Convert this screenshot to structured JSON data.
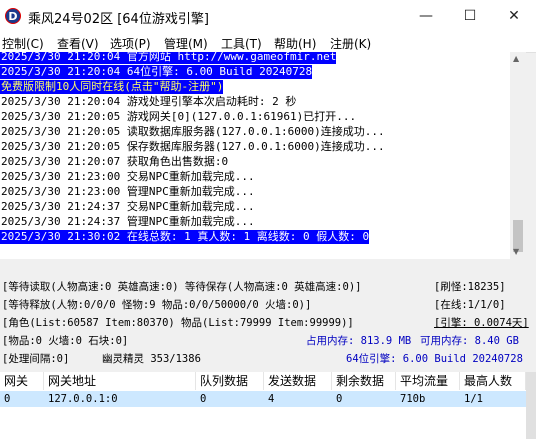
{
  "window": {
    "title": "乘风24号02区 [64位游戏引擎]",
    "icon_letter": "D",
    "minimize": "—",
    "maximize": "☐",
    "close": "✕"
  },
  "menu": [
    "控制(C)",
    "查看(V)",
    "选项(P)",
    "管理(M)",
    "工具(T)",
    "帮助(H)",
    "注册(K)"
  ],
  "log": [
    {
      "text": "2025/3/30 21:20:04 官方网站 http://www.gameofmir.net",
      "style": "sel"
    },
    {
      "text": "2025/3/30 21:20:04 64位引擎: 6.00 Build 20240728",
      "style": "sel"
    },
    {
      "text": "免费版限制10人同时在线(点击\"帮助-注册\")",
      "style": "hot"
    },
    {
      "text": "2025/3/30 21:20:04 游戏处理引擎本次启动耗时: 2 秒",
      "style": ""
    },
    {
      "text": "2025/3/30 21:20:05 游戏网关[0](127.0.0.1:61961)已打开...",
      "style": ""
    },
    {
      "text": "2025/3/30 21:20:05 读取数据库服务器(127.0.0.1:6000)连接成功...",
      "style": ""
    },
    {
      "text": "2025/3/30 21:20:05 保存数据库服务器(127.0.0.1:6000)连接成功...",
      "style": ""
    },
    {
      "text": "2025/3/30 21:20:07 获取角色出售数据:0",
      "style": ""
    },
    {
      "text": "2025/3/30 21:23:00 交易NPC重新加载完成...",
      "style": ""
    },
    {
      "text": "2025/3/30 21:23:00 管理NPC重新加载完成...",
      "style": ""
    },
    {
      "text": "2025/3/30 21:24:37 交易NPC重新加载完成...",
      "style": ""
    },
    {
      "text": "2025/3/30 21:24:37 管理NPC重新加载完成...",
      "style": ""
    },
    {
      "text": "2025/3/30 21:30:02 在线总数: 1 真人数: 1 离线数: 0 假人数: 0",
      "style": "sel"
    }
  ],
  "status": {
    "read_wait": "[等待读取(人物高速:0 英雄高速:0) 等待保存(人物高速:0 英雄高速:0)]",
    "refresh": "[刷怪:18235]",
    "release_wait": "[等待释放(人物:0/0/0 怪物:9 物品:0/0/50000/0 火墙:0)]",
    "online": "[在线:1/1/0]",
    "role": "[角色(List:60587 Item:80370) 物品(List:79999 Item:99999)]",
    "engine": "[引擎: 0.0074天]",
    "items": "[物品:0 火墙:0 石块:0]",
    "mem_used": "占用内存: 813.9 MB",
    "mem_avail": "可用内存: 8.40 GB",
    "interval": "[处理间隔:0]",
    "sprite": "幽灵精灵 353/1386",
    "engine_ver": "64位引擎: 6.00 Build 20240728"
  },
  "table": {
    "headers": [
      "网关",
      "网关地址",
      "队列数据",
      "发送数据",
      "剩余数据",
      "平均流量",
      "最高人数"
    ],
    "rows": [
      [
        "0",
        "127.0.0.1:0",
        "0",
        "4",
        "0",
        "710b",
        "1/1"
      ]
    ]
  }
}
